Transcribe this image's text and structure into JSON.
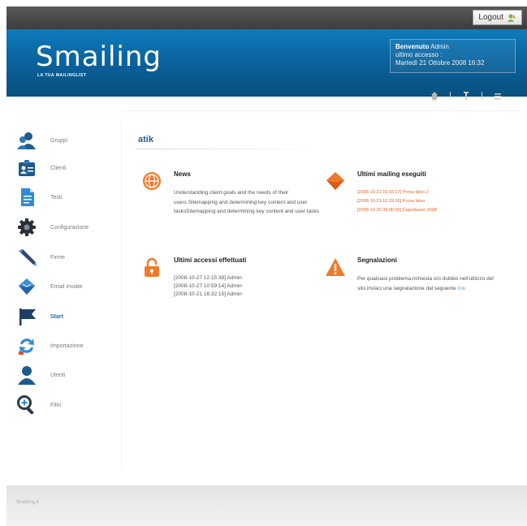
{
  "topbar": {
    "logout_label": "Logout"
  },
  "header": {
    "logo": "Smailing",
    "tagline": "LA TUA MAILINGLIST",
    "welcome_bold": "Benvenuto",
    "welcome_user": " Admin",
    "last_access_label": "ultimo accesso :",
    "last_access_date": "Martedì 21 Ottobre 2008 16:32"
  },
  "sidebar": {
    "items": [
      {
        "label": "Gruppi",
        "icon": "group-icon"
      },
      {
        "label": "Clienti",
        "icon": "contact-card-icon"
      },
      {
        "label": "Testi",
        "icon": "document-icon"
      },
      {
        "label": "Configurazione",
        "icon": "gear-icon"
      },
      {
        "label": "Firme",
        "icon": "pen-icon"
      },
      {
        "label": "Email inviate",
        "icon": "sent-email-icon"
      },
      {
        "label": "Start",
        "icon": "flag-icon",
        "active": true
      },
      {
        "label": "Importazione",
        "icon": "import-icon"
      },
      {
        "label": "Utenti",
        "icon": "user-icon"
      },
      {
        "label": "Filtri",
        "icon": "search-filter-icon"
      }
    ]
  },
  "main": {
    "title": "atik",
    "news": {
      "title": "News",
      "body": "Understanding client goals and the needs of their users.Sitemapping and determining key content and user tasksSitemapping and determining key content and user tasks"
    },
    "mailing": {
      "title": "Ultimi mailing eseguiti",
      "items": [
        "[2008-10-21 16:33:17] Prova falso 2",
        "[2008-10-21 16:29:16] Prova falso",
        "[2008-10-20 09:06:02] Capodanno 2008"
      ]
    },
    "access": {
      "title": "Ultimi accessi effettuati",
      "items": [
        "[2008-10-27 12:15:38] Admin",
        "[2008-10-27 10:59:14] Admin",
        "[2008-10-21 16:32:15] Admin"
      ]
    },
    "reports": {
      "title": "Segnalazioni",
      "body": "Per qualsiasi problema,richiesta o/o dubbio nell'utilizzo del sito,inviaci una segnalazione dal seguente ",
      "link": "link"
    }
  },
  "footer": {
    "text": "Smailing.it"
  },
  "colors": {
    "header_blue": "#0a5f98",
    "accent_orange": "#e2632d",
    "active_blue": "#2a6eb0"
  }
}
